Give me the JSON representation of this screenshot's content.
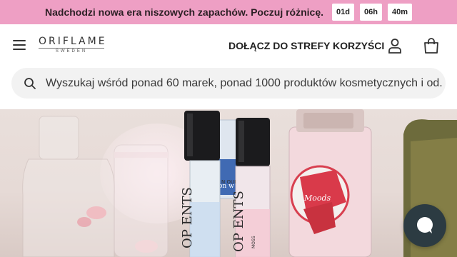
{
  "promo": {
    "text": "Nadchodzi nowa era niszowych zapachów. Poczuj różnicę.",
    "timer": {
      "days": "01d",
      "hours": "06h",
      "minutes": "40m"
    },
    "background_color": "#ee9fc4"
  },
  "header": {
    "menu_icon": "hamburger-menu-icon",
    "logo": {
      "name": "ORIFLAME",
      "sub": "SWEDEN"
    },
    "join_link": "DOŁĄCZ DO STREFY KORZYŚCI",
    "user_icon": "user-icon",
    "bag_icon": "shopping-bag-icon"
  },
  "search": {
    "placeholder": "Wyszukaj wśród ponad 60 marek, ponad 1000 produktów kosmetycznych i od...",
    "icon": "search-icon"
  },
  "hero": {
    "label_left": "OP\nENTS",
    "label_mid": "N OUD",
    "label_right": "OP\nENTS",
    "label_right_sub": "MOSS",
    "bottle_label": "Moods",
    "bottle_small_text": "on w"
  },
  "chat": {
    "icon": "chat-bubble-icon",
    "color": "#2c3b42"
  }
}
